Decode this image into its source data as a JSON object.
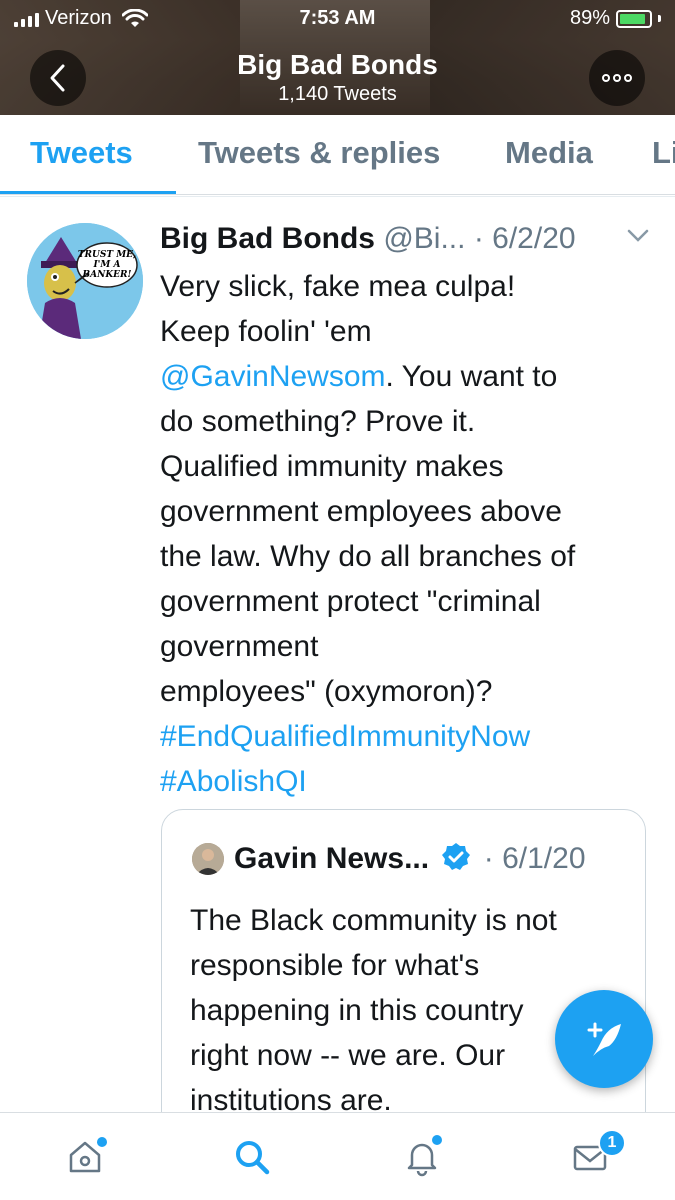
{
  "status_bar": {
    "carrier": "Verizon",
    "time": "7:53 AM",
    "battery": "89%",
    "battery_level": 0.89,
    "battery_color": "#4cd964"
  },
  "profile": {
    "name": "Big Bad Bonds",
    "tweet_count": "1,140 Tweets",
    "back_icon": "chevron-left-icon",
    "more_icon": "more-horizontal-icon"
  },
  "tabs": [
    {
      "label": "Tweets",
      "active": true
    },
    {
      "label": "Tweets & replies",
      "active": false
    },
    {
      "label": "Media",
      "active": false
    },
    {
      "label": "Likes",
      "active": false
    }
  ],
  "tweet": {
    "author": "Big Bad Bonds",
    "handle": "@Bi...",
    "date": "6/2/20",
    "separator": " · ",
    "avatar_text": [
      "TRUST ME,",
      "I'M A",
      "BANKER!"
    ],
    "lines": [
      "Very slick, fake mea culpa!",
      "Keep foolin' 'em",
      "@GavinNewsom",
      ". You want to",
      "do something? Prove it.",
      "Qualified immunity makes",
      "government employees above",
      "the law. Why do all branches of",
      "government protect \"criminal",
      "government",
      "employees\" (oxymoron)?",
      "#EndQualifiedImmunityNow",
      "#AbolishQI"
    ],
    "quote": {
      "author": "Gavin News...",
      "date": "6/1/20",
      "separator": " · ",
      "lines": [
        "The Black community is not",
        "responsible for what's",
        "happening in this country",
        "right now -- we are. Our",
        "institutions are."
      ]
    }
  },
  "fab": {
    "icon": "compose-tweet-icon"
  },
  "bottom_nav": {
    "items": [
      {
        "icon": "home-icon",
        "dot": true
      },
      {
        "icon": "search-icon",
        "active": true
      },
      {
        "icon": "notifications-bell-icon",
        "dot": true
      },
      {
        "icon": "messages-envelope-icon",
        "badge": "1"
      }
    ]
  },
  "colors": {
    "accent": "#1da1f2",
    "text": "#14171a",
    "secondary": "#657786"
  }
}
